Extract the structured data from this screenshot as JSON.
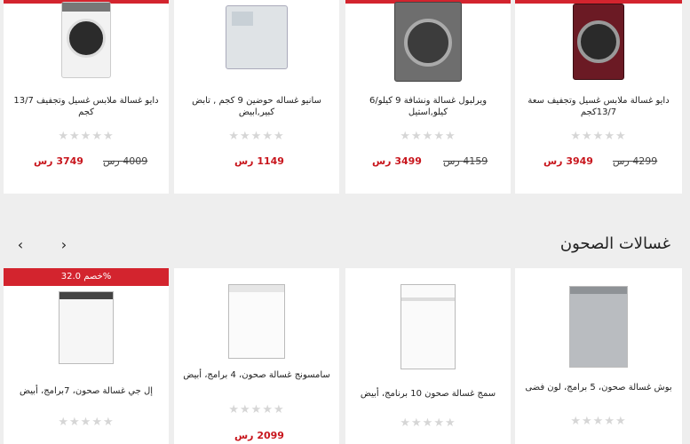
{
  "washers": [
    {
      "name": "دايو غسالة ملابس غسيل وتجفيف سعة 13/7كجم",
      "price": "3949 رس",
      "old": "4299 رس",
      "stars": "★★★★★"
    },
    {
      "name": "ويرلبول غسالة ونشافة 9 كيلو/6 كيلو,استيل",
      "price": "3499 رس",
      "old": "4159 رس",
      "stars": "★★★★★"
    },
    {
      "name": "سانيو غساله حوضين 9 كجم , تابض كبير,ابيض",
      "price": "1149 رس",
      "old": "",
      "stars": "★★★★★"
    },
    {
      "name": "دايو غسالة ملابس غسيل وتجفيف 13/7 كجم",
      "price": "3749 رس",
      "old": "4009 رس",
      "stars": "★★★★★"
    }
  ],
  "section": {
    "title": "غسالات الصحون",
    "prev": "›",
    "next": "‹"
  },
  "dishwashers": [
    {
      "name": "بوش غسالة صحون، 5 برامج، لون فضى",
      "price": "",
      "old": "",
      "stars": "★★★★★",
      "badge": ""
    },
    {
      "name": "سمج غسالة صحون 10 برنامج، أبيض",
      "price": "",
      "old": "",
      "stars": "★★★★★",
      "badge": ""
    },
    {
      "name": "سامسونج غسالة صحون، 4 برامج، أبيض",
      "price": "2099 رس",
      "old": "",
      "stars": "★★★★★",
      "badge": ""
    },
    {
      "name": "إل جي غسالة صحون، 7برامج، أبيض",
      "price": "",
      "old": "",
      "stars": "★★★★★",
      "badge": "خصم 32.0%"
    }
  ]
}
